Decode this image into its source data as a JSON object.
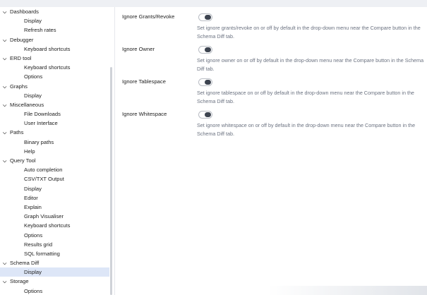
{
  "sidebar": {
    "items": [
      {
        "label": "Dashboards",
        "level": "group",
        "expanded": true
      },
      {
        "label": "Display",
        "level": "child"
      },
      {
        "label": "Refresh rates",
        "level": "child"
      },
      {
        "label": "Debugger",
        "level": "group",
        "expanded": true
      },
      {
        "label": "Keyboard shortcuts",
        "level": "child"
      },
      {
        "label": "ERD tool",
        "level": "group",
        "expanded": true
      },
      {
        "label": "Keyboard shortcuts",
        "level": "child"
      },
      {
        "label": "Options",
        "level": "child"
      },
      {
        "label": "Graphs",
        "level": "group",
        "expanded": true
      },
      {
        "label": "Display",
        "level": "child"
      },
      {
        "label": "Miscellaneous",
        "level": "group",
        "expanded": true
      },
      {
        "label": "File Downloads",
        "level": "child"
      },
      {
        "label": "User Interface",
        "level": "child"
      },
      {
        "label": "Paths",
        "level": "group",
        "expanded": true
      },
      {
        "label": "Binary paths",
        "level": "child"
      },
      {
        "label": "Help",
        "level": "child"
      },
      {
        "label": "Query Tool",
        "level": "group",
        "expanded": true
      },
      {
        "label": "Auto completion",
        "level": "child"
      },
      {
        "label": "CSV/TXT Output",
        "level": "child"
      },
      {
        "label": "Display",
        "level": "child"
      },
      {
        "label": "Editor",
        "level": "child"
      },
      {
        "label": "Explain",
        "level": "child"
      },
      {
        "label": "Graph Visualiser",
        "level": "child"
      },
      {
        "label": "Keyboard shortcuts",
        "level": "child"
      },
      {
        "label": "Options",
        "level": "child"
      },
      {
        "label": "Results grid",
        "level": "child"
      },
      {
        "label": "SQL formatting",
        "level": "child"
      },
      {
        "label": "Schema Diff",
        "level": "group",
        "expanded": true
      },
      {
        "label": "Display",
        "level": "child",
        "selected": true
      },
      {
        "label": "Storage",
        "level": "group",
        "expanded": true
      },
      {
        "label": "Options",
        "level": "child"
      }
    ]
  },
  "settings": [
    {
      "label": "Ignore Grants/Revoke",
      "enabled": false,
      "description": "Set ignore grants/revoke on or off by default in the drop-down menu near the Compare button in the Schema Diff tab."
    },
    {
      "label": "Ignore Owner",
      "enabled": false,
      "description": "Set ignore owner on or off by default in the drop-down menu near the Compare button in the Schema Diff tab."
    },
    {
      "label": "Ignore Tablespace",
      "enabled": false,
      "description": "Set ignore tablespace on or off by default in the drop-down menu near the Compare button in the Schema Diff tab."
    },
    {
      "label": "Ignore Whitespace",
      "enabled": false,
      "description": "Set ignore whitespace on or off by default in the drop-down menu near the Compare button in the Schema Diff tab."
    }
  ],
  "icons": {
    "expanded": "chevron-down-icon"
  },
  "colors": {
    "selected_bg": "#dde6f7",
    "toggle_knob": "#3d4450",
    "description_text": "#6b7280"
  }
}
